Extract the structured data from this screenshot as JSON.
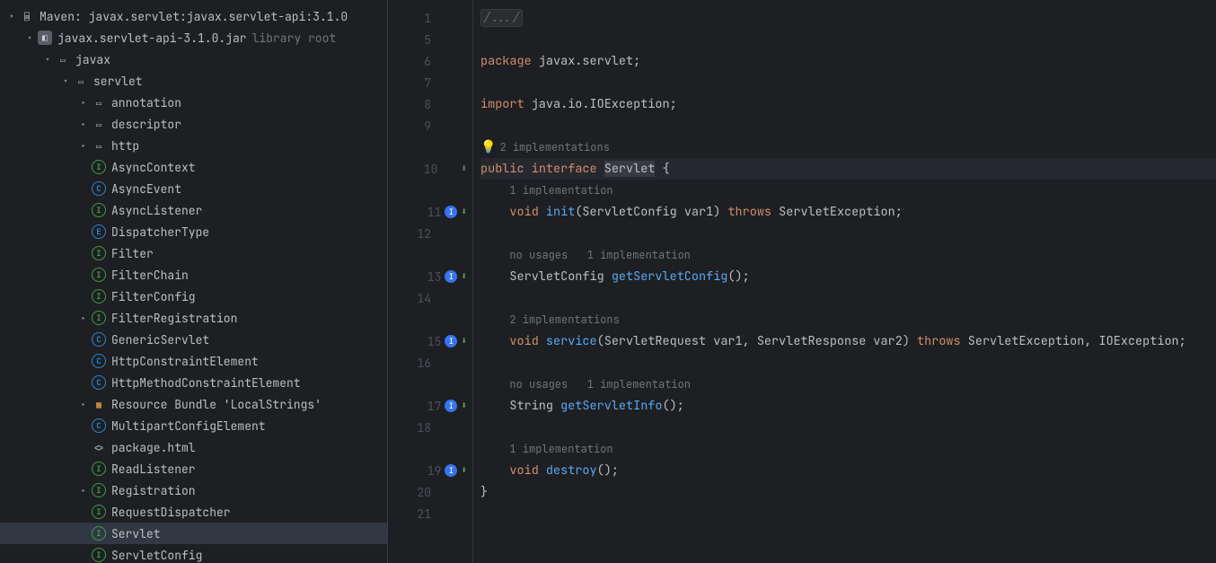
{
  "tree": {
    "lib_root": "Maven: javax.servlet:javax.servlet-api:3.1.0",
    "jar": "javax.servlet-api-3.1.0.jar",
    "jar_hint": "library root",
    "pkg_javax": "javax",
    "pkg_servlet": "servlet",
    "items": [
      {
        "icon": "folder",
        "label": "annotation",
        "expandable": true
      },
      {
        "icon": "folder",
        "label": "descriptor",
        "expandable": true
      },
      {
        "icon": "folder",
        "label": "http",
        "expandable": true
      },
      {
        "icon": "interface",
        "label": "AsyncContext"
      },
      {
        "icon": "class",
        "label": "AsyncEvent"
      },
      {
        "icon": "interface",
        "label": "AsyncListener"
      },
      {
        "icon": "enum",
        "label": "DispatcherType"
      },
      {
        "icon": "interface",
        "label": "Filter"
      },
      {
        "icon": "interface",
        "label": "FilterChain"
      },
      {
        "icon": "interface",
        "label": "FilterConfig"
      },
      {
        "icon": "interface",
        "label": "FilterRegistration",
        "expandable": true
      },
      {
        "icon": "class",
        "label": "GenericServlet"
      },
      {
        "icon": "class",
        "label": "HttpConstraintElement"
      },
      {
        "icon": "class",
        "label": "HttpMethodConstraintElement"
      },
      {
        "icon": "bundle",
        "label": "Resource Bundle 'LocalStrings'",
        "expandable": true
      },
      {
        "icon": "class",
        "label": "MultipartConfigElement"
      },
      {
        "icon": "html",
        "label": "package.html"
      },
      {
        "icon": "interface",
        "label": "ReadListener"
      },
      {
        "icon": "interface",
        "label": "Registration",
        "expandable": true
      },
      {
        "icon": "interface",
        "label": "RequestDispatcher"
      },
      {
        "icon": "interface",
        "label": "Servlet",
        "selected": true
      },
      {
        "icon": "interface",
        "label": "ServletConfig"
      }
    ]
  },
  "code": {
    "fold": "/.../",
    "pkg_kw": "package",
    "pkg_stmt": " javax.servlet;",
    "import_kw": "import",
    "import_stmt": " java.io.IOException;",
    "hint_2impl": "2 implementations",
    "public": "public",
    "interface": "interface",
    "servlet": "Servlet",
    "brace_open": " {",
    "hint_1impl": "1 implementation",
    "void": "void",
    "init": "init",
    "init_sig": "(ServletConfig var1) ",
    "throws": "throws",
    "servletex": " ServletException;",
    "hint_nou_1i": "no usages   1 implementation",
    "sc_type": "ServletConfig ",
    "getsc": "getServletConfig",
    "empty_call": "();",
    "hint_2impls": "2 implementations",
    "service": "service",
    "service_sig": "(ServletRequest var1, ServletResponse var2) ",
    "service_throws": " ServletException, IOException;",
    "string": "String ",
    "getinfo": "getServletInfo",
    "destroy": "destroy",
    "brace_close": "}",
    "lines": {
      "l1": "1",
      "l5": "5",
      "l6": "6",
      "l7": "7",
      "l8": "8",
      "l9": "9",
      "l10": "10",
      "l11": "11",
      "l12": "12",
      "l13": "13",
      "l14": "14",
      "l15": "15",
      "l16": "16",
      "l17": "17",
      "l18": "18",
      "l19": "19",
      "l20": "20",
      "l21": "21"
    }
  }
}
